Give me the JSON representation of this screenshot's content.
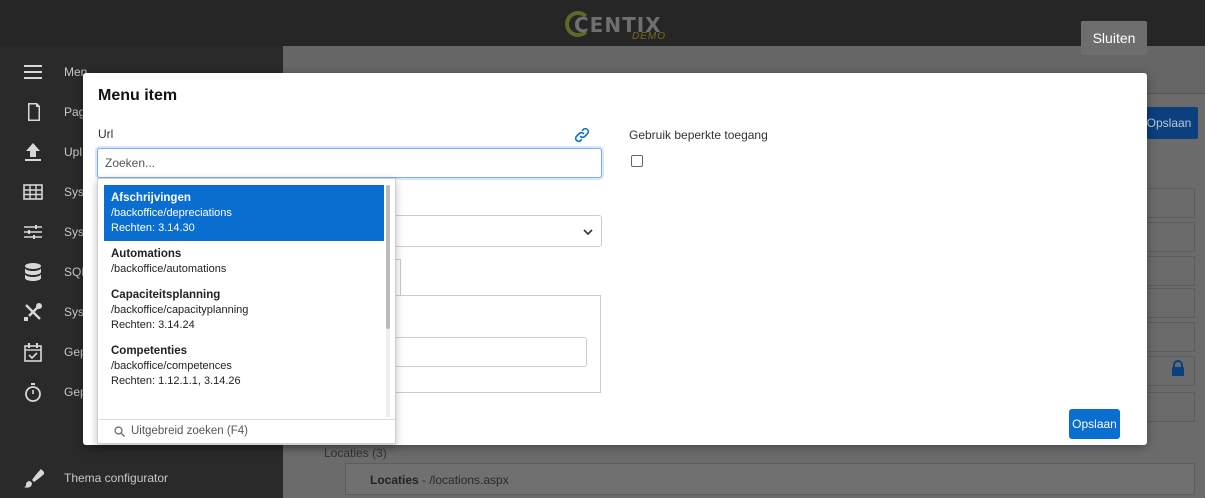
{
  "app": {
    "logo_text": "CENTIX",
    "logo_sub": "DEMO",
    "close_label": "Sluiten"
  },
  "sidebar": {
    "items": [
      {
        "label": "Men",
        "icon": "menu-icon"
      },
      {
        "label": "Pag",
        "icon": "page-icon"
      },
      {
        "label": "Upl",
        "icon": "upload-icon"
      },
      {
        "label": "Sys",
        "icon": "table-icon"
      },
      {
        "label": "Sys",
        "icon": "sliders-icon"
      },
      {
        "label": "SQL",
        "icon": "database-icon"
      },
      {
        "label": "Sys",
        "icon": "tools-icon"
      },
      {
        "label": "Gep",
        "icon": "calendar-check-icon"
      },
      {
        "label": "Gep",
        "icon": "stopwatch-icon"
      },
      {
        "label": "Thema configurator",
        "icon": "brush-icon"
      }
    ]
  },
  "background": {
    "save_label": "Opslaan",
    "locaties_header": "Locaties (3)",
    "locaties_row_name": "Locaties",
    "locaties_row_path": " - /locations.aspx"
  },
  "modal": {
    "title": "Menu item",
    "url_label": "Url",
    "search_placeholder": "Zoeken...",
    "restricted_label": "Gebruik beperkte toegang",
    "restricted_checked": false,
    "save_label": "Opslaan"
  },
  "dropdown": {
    "items": [
      {
        "title": "Afschrijvingen",
        "path": "/backoffice/depreciations",
        "rights": "Rechten: 3.14.30",
        "active": true
      },
      {
        "title": "Automations",
        "path": "/backoffice/automations",
        "rights": ""
      },
      {
        "title": "Capaciteitsplanning",
        "path": "/backoffice/capacityplanning",
        "rights": "Rechten: 3.14.24"
      },
      {
        "title": "Competenties",
        "path": "/backoffice/competences",
        "rights": "Rechten: 1.12.1.1, 3.14.26"
      }
    ],
    "footer_label": "Uitgebreid zoeken (F4)"
  },
  "colors": {
    "accent": "#0a6ed1",
    "topbar": "#262626",
    "sidebar": "#2a2a2a"
  }
}
